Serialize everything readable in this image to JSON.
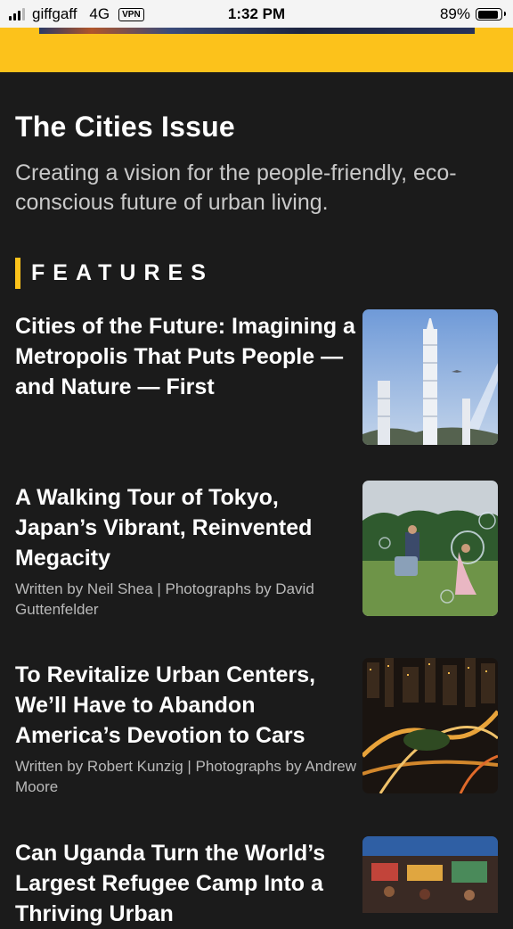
{
  "status_bar": {
    "carrier": "giffgaff",
    "network": "4G",
    "vpn": "VPN",
    "time": "1:32 PM",
    "battery_percent": "89%",
    "battery_level": 0.89
  },
  "issue": {
    "title": "The Cities Issue",
    "description": "Creating a vision for the people-friendly, eco-conscious future of urban living."
  },
  "section": {
    "title": "FEATURES",
    "accent_color": "#fcc21b"
  },
  "features": [
    {
      "title": "Cities of the Future: Imagining a Metropolis That Puts People — and Nature — First",
      "byline": "",
      "image": "futuristic-towers-image"
    },
    {
      "title": "A Walking Tour of Tokyo, Japan’s Vibrant, Reinvented Megacity",
      "byline": "Written by Neil Shea | Photographs by David Guttenfelder",
      "image": "park-bubbles-image"
    },
    {
      "title": "To Revitalize Urban Centers, We’ll Have to Abandon America’s Devotion to Cars",
      "byline": "Written by Robert Kunzig | Photographs by Andrew Moore",
      "image": "highway-interchange-night-image"
    },
    {
      "title": "Can Uganda Turn the World’s Largest Refugee Camp Into a Thriving Urban",
      "byline": "",
      "image": "refugee-camp-market-image"
    }
  ]
}
